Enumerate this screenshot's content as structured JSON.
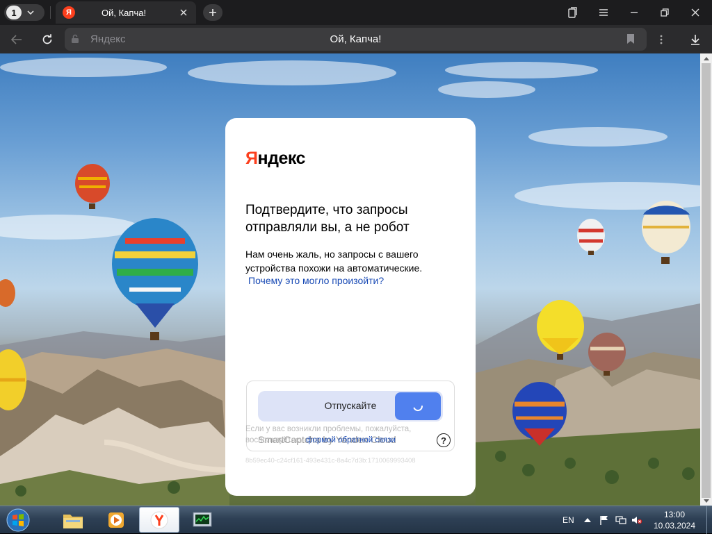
{
  "browser": {
    "tab_count": "1",
    "tab_title": "Ой, Капча!",
    "favicon_letter": "Я",
    "address_domain": "Яндекс",
    "address_title": "Ой, Капча!"
  },
  "captcha": {
    "logo_prefix": "Я",
    "logo_rest": "ндекс",
    "headline": "Подтвердите, что запросы отправляли вы, а не робот",
    "body": "Нам очень жаль, но запросы с вашего устройства похожи на автоматические.",
    "why_link": "Почему это могло произойти?",
    "slider_label": "Отпускайте",
    "brand": "SmartCaptcha by Yandex Cloud",
    "help_symbol": "?",
    "footer_prefix": "Если у вас возникли проблемы, пожалуйста, воспользуйтесь",
    "footer_link": "формой обратной связи",
    "request_id": "8b59ec40-c24cf161-493e431c-8a4c7d3b:1710069993408"
  },
  "taskbar": {
    "language": "EN",
    "time": "13:00",
    "date": "10.03.2024"
  },
  "icons": [
    "tab-list-chevron-icon",
    "close-icon",
    "plus-icon",
    "collections-icon",
    "menu-icon",
    "minimize-icon",
    "restore-icon",
    "back-icon",
    "reload-icon",
    "lock-icon",
    "bookmark-icon",
    "kebab-icon",
    "download-icon",
    "spinner-icon",
    "help-icon",
    "windows-start-icon",
    "file-explorer-icon",
    "media-player-icon",
    "yandex-browser-icon",
    "task-manager-icon",
    "flag-icon",
    "network-icon",
    "volume-muted-icon"
  ],
  "colors": {
    "yandex_red": "#fc3f1d",
    "slider_handle": "#5080ee",
    "slider_track": "#dde3f7",
    "link": "#1a4bb5"
  }
}
